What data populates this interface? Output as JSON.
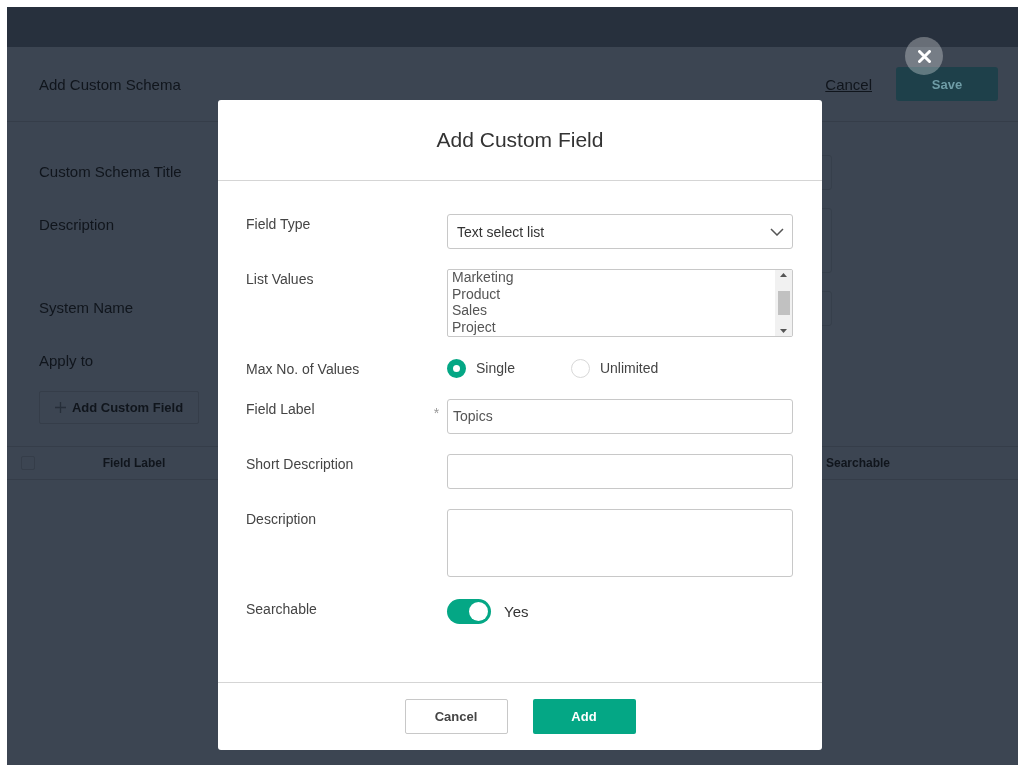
{
  "page": {
    "title": "Add Custom Schema",
    "cancel": "Cancel",
    "save": "Save",
    "fields": [
      {
        "label": "Custom Schema Title",
        "kind": "input"
      },
      {
        "label": "Description",
        "kind": "textarea"
      },
      {
        "label": "System Name",
        "kind": "input"
      },
      {
        "label": "Apply to",
        "kind": "none"
      }
    ],
    "add_button": "Add Custom Field",
    "table": {
      "select_all_checked": false,
      "columns": [
        "Field Label",
        "Searchable"
      ]
    }
  },
  "modal": {
    "title": "Add Custom Field",
    "field_type": {
      "label": "Field Type",
      "value": "Text select list"
    },
    "list_values": {
      "label": "List Values",
      "items": [
        "Marketing",
        "Product",
        "Sales",
        "Project"
      ]
    },
    "max_values": {
      "label": "Max No. of Values",
      "options": [
        {
          "label": "Single",
          "selected": true
        },
        {
          "label": "Unlimited",
          "selected": false
        }
      ]
    },
    "field_label": {
      "label": "Field Label",
      "required_mark": "*",
      "value": "Topics"
    },
    "short_description": {
      "label": "Short Description"
    },
    "description": {
      "label": "Description"
    },
    "searchable": {
      "label": "Searchable",
      "on": true,
      "text": "Yes"
    },
    "buttons": {
      "cancel": "Cancel",
      "add": "Add"
    }
  }
}
